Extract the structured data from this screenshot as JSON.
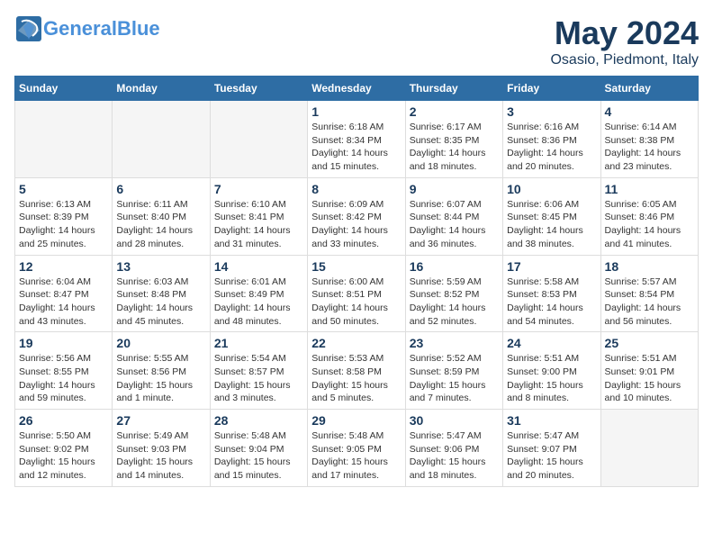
{
  "logo": {
    "brand": "General",
    "brand_accent": "Blue",
    "tagline": ""
  },
  "header": {
    "title": "May 2024",
    "subtitle": "Osasio, Piedmont, Italy"
  },
  "weekdays": [
    "Sunday",
    "Monday",
    "Tuesday",
    "Wednesday",
    "Thursday",
    "Friday",
    "Saturday"
  ],
  "weeks": [
    [
      {
        "day": "",
        "info": ""
      },
      {
        "day": "",
        "info": ""
      },
      {
        "day": "",
        "info": ""
      },
      {
        "day": "1",
        "info": "Sunrise: 6:18 AM\nSunset: 8:34 PM\nDaylight: 14 hours\nand 15 minutes."
      },
      {
        "day": "2",
        "info": "Sunrise: 6:17 AM\nSunset: 8:35 PM\nDaylight: 14 hours\nand 18 minutes."
      },
      {
        "day": "3",
        "info": "Sunrise: 6:16 AM\nSunset: 8:36 PM\nDaylight: 14 hours\nand 20 minutes."
      },
      {
        "day": "4",
        "info": "Sunrise: 6:14 AM\nSunset: 8:38 PM\nDaylight: 14 hours\nand 23 minutes."
      }
    ],
    [
      {
        "day": "5",
        "info": "Sunrise: 6:13 AM\nSunset: 8:39 PM\nDaylight: 14 hours\nand 25 minutes."
      },
      {
        "day": "6",
        "info": "Sunrise: 6:11 AM\nSunset: 8:40 PM\nDaylight: 14 hours\nand 28 minutes."
      },
      {
        "day": "7",
        "info": "Sunrise: 6:10 AM\nSunset: 8:41 PM\nDaylight: 14 hours\nand 31 minutes."
      },
      {
        "day": "8",
        "info": "Sunrise: 6:09 AM\nSunset: 8:42 PM\nDaylight: 14 hours\nand 33 minutes."
      },
      {
        "day": "9",
        "info": "Sunrise: 6:07 AM\nSunset: 8:44 PM\nDaylight: 14 hours\nand 36 minutes."
      },
      {
        "day": "10",
        "info": "Sunrise: 6:06 AM\nSunset: 8:45 PM\nDaylight: 14 hours\nand 38 minutes."
      },
      {
        "day": "11",
        "info": "Sunrise: 6:05 AM\nSunset: 8:46 PM\nDaylight: 14 hours\nand 41 minutes."
      }
    ],
    [
      {
        "day": "12",
        "info": "Sunrise: 6:04 AM\nSunset: 8:47 PM\nDaylight: 14 hours\nand 43 minutes."
      },
      {
        "day": "13",
        "info": "Sunrise: 6:03 AM\nSunset: 8:48 PM\nDaylight: 14 hours\nand 45 minutes."
      },
      {
        "day": "14",
        "info": "Sunrise: 6:01 AM\nSunset: 8:49 PM\nDaylight: 14 hours\nand 48 minutes."
      },
      {
        "day": "15",
        "info": "Sunrise: 6:00 AM\nSunset: 8:51 PM\nDaylight: 14 hours\nand 50 minutes."
      },
      {
        "day": "16",
        "info": "Sunrise: 5:59 AM\nSunset: 8:52 PM\nDaylight: 14 hours\nand 52 minutes."
      },
      {
        "day": "17",
        "info": "Sunrise: 5:58 AM\nSunset: 8:53 PM\nDaylight: 14 hours\nand 54 minutes."
      },
      {
        "day": "18",
        "info": "Sunrise: 5:57 AM\nSunset: 8:54 PM\nDaylight: 14 hours\nand 56 minutes."
      }
    ],
    [
      {
        "day": "19",
        "info": "Sunrise: 5:56 AM\nSunset: 8:55 PM\nDaylight: 14 hours\nand 59 minutes."
      },
      {
        "day": "20",
        "info": "Sunrise: 5:55 AM\nSunset: 8:56 PM\nDaylight: 15 hours\nand 1 minute."
      },
      {
        "day": "21",
        "info": "Sunrise: 5:54 AM\nSunset: 8:57 PM\nDaylight: 15 hours\nand 3 minutes."
      },
      {
        "day": "22",
        "info": "Sunrise: 5:53 AM\nSunset: 8:58 PM\nDaylight: 15 hours\nand 5 minutes."
      },
      {
        "day": "23",
        "info": "Sunrise: 5:52 AM\nSunset: 8:59 PM\nDaylight: 15 hours\nand 7 minutes."
      },
      {
        "day": "24",
        "info": "Sunrise: 5:51 AM\nSunset: 9:00 PM\nDaylight: 15 hours\nand 8 minutes."
      },
      {
        "day": "25",
        "info": "Sunrise: 5:51 AM\nSunset: 9:01 PM\nDaylight: 15 hours\nand 10 minutes."
      }
    ],
    [
      {
        "day": "26",
        "info": "Sunrise: 5:50 AM\nSunset: 9:02 PM\nDaylight: 15 hours\nand 12 minutes."
      },
      {
        "day": "27",
        "info": "Sunrise: 5:49 AM\nSunset: 9:03 PM\nDaylight: 15 hours\nand 14 minutes."
      },
      {
        "day": "28",
        "info": "Sunrise: 5:48 AM\nSunset: 9:04 PM\nDaylight: 15 hours\nand 15 minutes."
      },
      {
        "day": "29",
        "info": "Sunrise: 5:48 AM\nSunset: 9:05 PM\nDaylight: 15 hours\nand 17 minutes."
      },
      {
        "day": "30",
        "info": "Sunrise: 5:47 AM\nSunset: 9:06 PM\nDaylight: 15 hours\nand 18 minutes."
      },
      {
        "day": "31",
        "info": "Sunrise: 5:47 AM\nSunset: 9:07 PM\nDaylight: 15 hours\nand 20 minutes."
      },
      {
        "day": "",
        "info": ""
      }
    ]
  ]
}
